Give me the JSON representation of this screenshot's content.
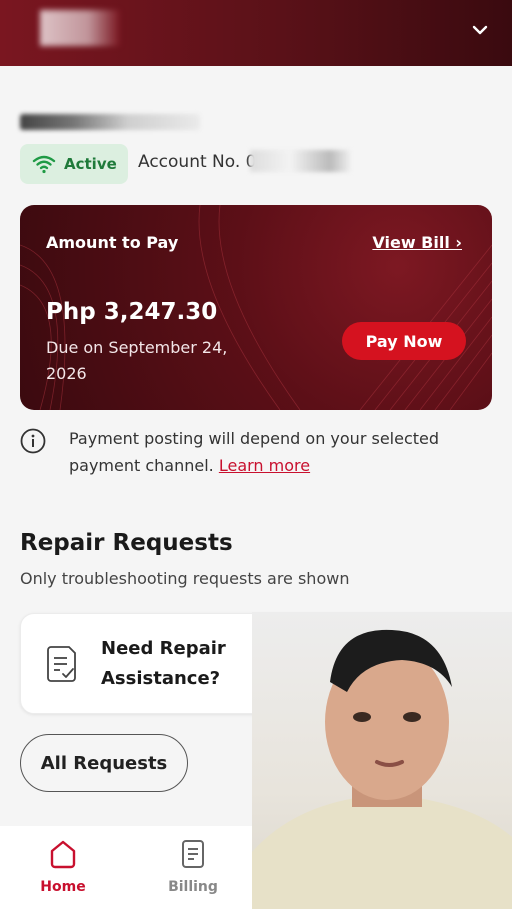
{
  "header": {
    "chevron_icon": "chevron-down-icon"
  },
  "account": {
    "status": "Active",
    "account_label": "Account No. 0",
    "status_color": "#1f7a3a",
    "status_bg": "#dcefe0"
  },
  "bill": {
    "amount_label": "Amount to Pay",
    "view_bill": "View Bill ›",
    "amount": "Php 3,247.30",
    "due": "Due on September 24, 2026",
    "pay_now": "Pay Now",
    "accent": "#d5121f"
  },
  "notice": {
    "text": "Payment posting will depend on your selected payment channel. ",
    "learn_more": "Learn more"
  },
  "repair": {
    "title": "Repair Requests",
    "subtitle": "Only troubleshooting requests are shown",
    "card_label": "Need Repair Assistance?",
    "all_requests": "All Requests"
  },
  "nav": {
    "items": [
      {
        "label": "Home",
        "icon": "home-icon",
        "active": true
      },
      {
        "label": "Billing",
        "icon": "billing-icon",
        "active": false
      }
    ]
  }
}
